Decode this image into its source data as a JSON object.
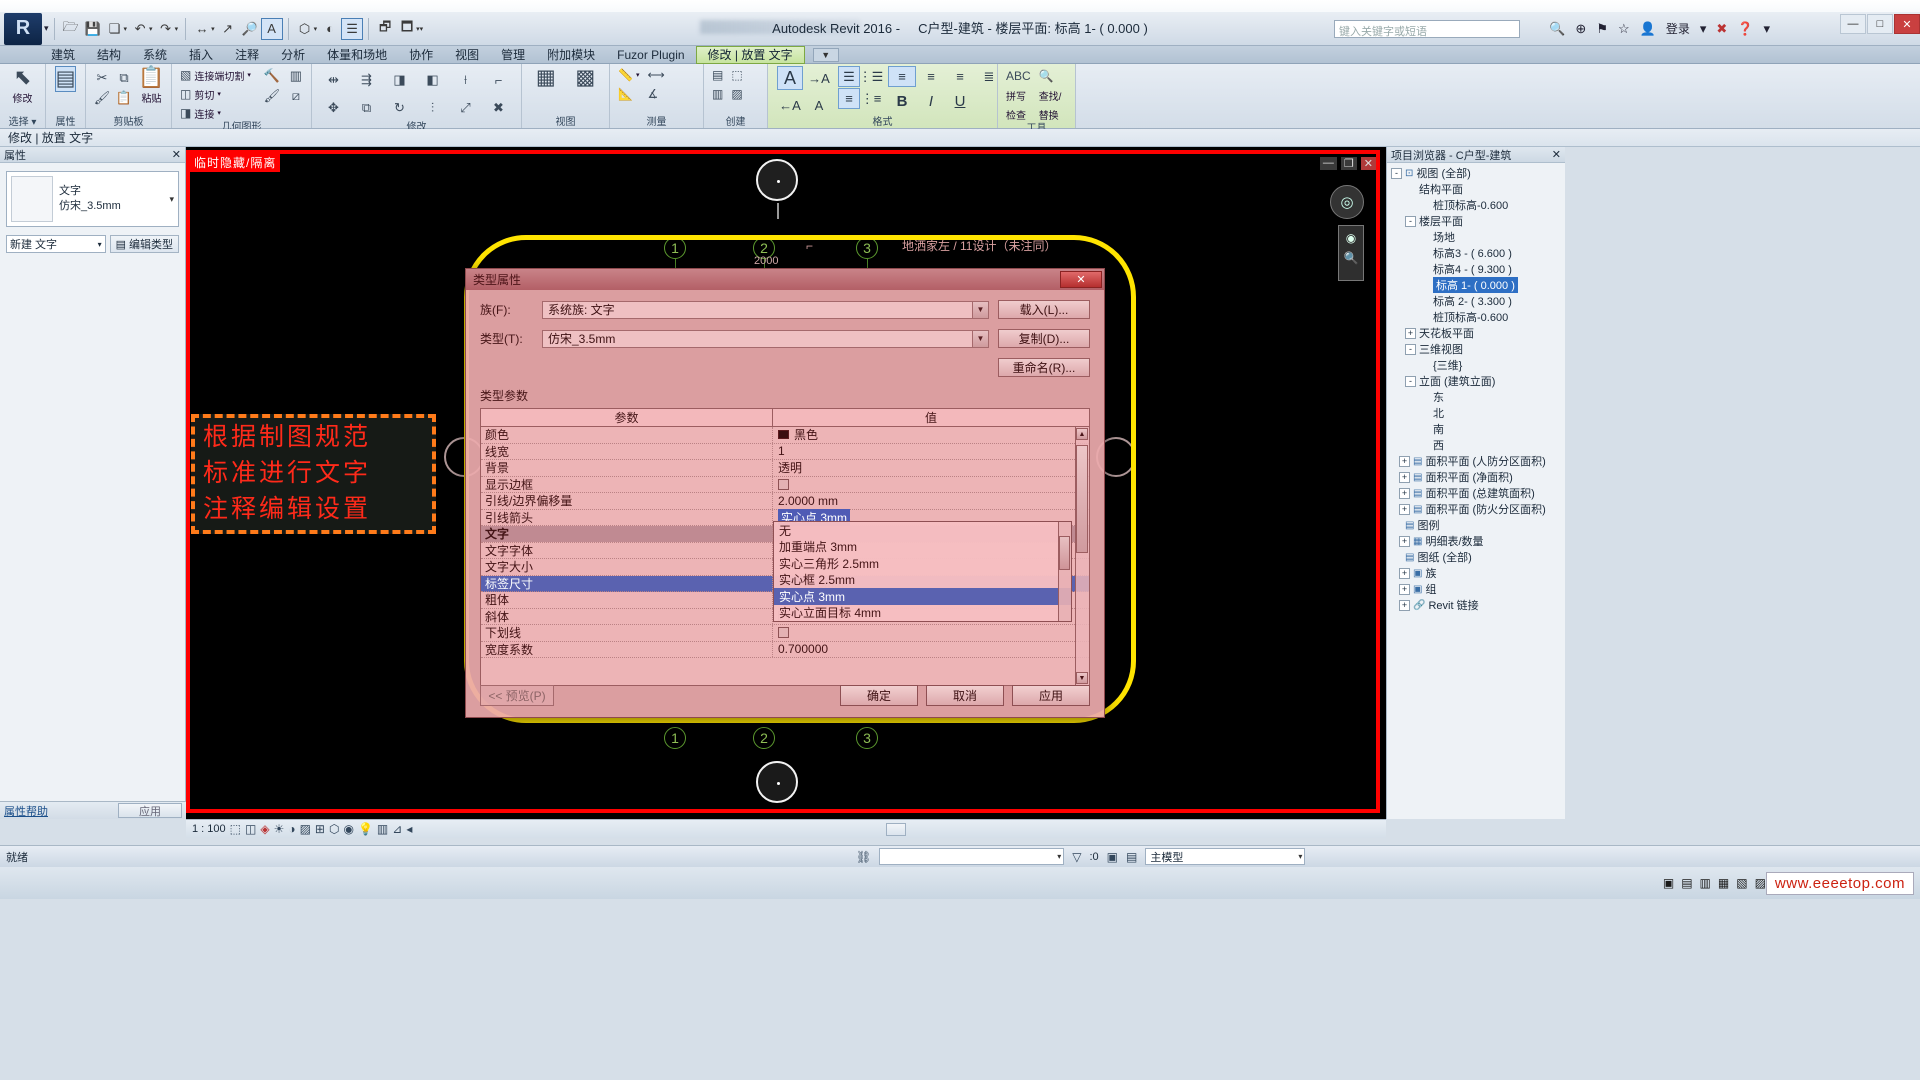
{
  "window": {
    "title": "Autodesk Revit 2016 -",
    "document": "C户型-建筑 - 楼层平面: 标高 1- ( 0.000 )",
    "search_placeholder": "键入关键字或短语",
    "signin": "登录",
    "minimize": "—",
    "maximize": "□",
    "close": "✕"
  },
  "quick_access": [
    {
      "name": "open-icon",
      "glyph": "🗁"
    },
    {
      "name": "save-icon",
      "glyph": "💾"
    },
    {
      "name": "save-as-icon",
      "glyph": "❐"
    },
    {
      "name": "undo-icon",
      "glyph": "↶"
    },
    {
      "name": "redo-icon",
      "glyph": "↷"
    },
    {
      "name": "measure-icon",
      "glyph": "↔"
    },
    {
      "name": "align-dimension-icon",
      "glyph": "↗"
    },
    {
      "name": "tag-icon",
      "glyph": "🔍"
    },
    {
      "name": "text-icon",
      "glyph": "A"
    },
    {
      "name": "default-3d-view-icon",
      "glyph": "⬡"
    },
    {
      "name": "section-icon",
      "glyph": "◔"
    },
    {
      "name": "thin-lines-icon",
      "glyph": "☰"
    },
    {
      "name": "close-hidden-windows-icon",
      "glyph": "🗗"
    },
    {
      "name": "switch-windows-icon",
      "glyph": "🗖"
    }
  ],
  "ribbon": {
    "tabs": [
      {
        "label": "建筑",
        "active": false
      },
      {
        "label": "结构",
        "active": false
      },
      {
        "label": "系统",
        "active": false
      },
      {
        "label": "插入",
        "active": false
      },
      {
        "label": "注释",
        "active": false
      },
      {
        "label": "分析",
        "active": false
      },
      {
        "label": "体量和场地",
        "active": false
      },
      {
        "label": "协作",
        "active": false
      },
      {
        "label": "视图",
        "active": false
      },
      {
        "label": "管理",
        "active": false
      },
      {
        "label": "附加模块",
        "active": false
      },
      {
        "label": "Fuzor Plugin",
        "active": false
      },
      {
        "label": "修改 | 放置 文字",
        "active": true
      }
    ],
    "tab_close": "▼",
    "panels": [
      {
        "title": "选择 ▾",
        "name": "select"
      },
      {
        "title": "属性",
        "name": "properties"
      },
      {
        "title": "剪贴板",
        "name": "clipboard"
      },
      {
        "title": "几何图形",
        "name": "geometry"
      },
      {
        "title": "修改",
        "name": "modify"
      },
      {
        "title": "视图",
        "name": "view"
      },
      {
        "title": "测量",
        "name": "measure"
      },
      {
        "title": "创建",
        "name": "create"
      },
      {
        "title": "格式",
        "name": "format"
      },
      {
        "title": "工具",
        "name": "tools"
      }
    ],
    "select_panel": {
      "modify_label": "修改"
    },
    "properties_panel": {
      "label": "属性"
    },
    "clipboard_panel": {
      "paste": "粘贴",
      "cut": "剪切",
      "copy": "复制",
      "match": "连接"
    },
    "geometry_panel": {
      "join_end": "连接端切割",
      "cut": "剪切",
      "join": "连接"
    },
    "format_panel": {
      "a_big": "A",
      "a_small": "A",
      "bold": "B",
      "italic": "I",
      "underline": "U"
    },
    "tools_panel": {
      "spell": "ABC",
      "check": "拼写\n检查",
      "find": "查找/\n替换"
    }
  },
  "context_bar": {
    "label": "修改 | 放置 文字"
  },
  "properties_palette": {
    "header": "属性",
    "close": "✕",
    "type_family": "文字",
    "type_name": "仿宋_3.5mm",
    "new_selector": "新建 文字",
    "edit_type": "编辑类型",
    "help_link": "属性帮助",
    "apply": "应用"
  },
  "canvas": {
    "view_control_label": "临时隐藏/隔离",
    "minimize": "—",
    "restore": "❐",
    "close": "✕",
    "dimension": "2000",
    "annotation": "地洒家左 / 11设计（未注同）",
    "grid_bubbles_top": [
      "1",
      "2",
      "3"
    ],
    "grid_bubbles_bottom": [
      "1",
      "2",
      "3"
    ]
  },
  "annotation_note": {
    "line1": "根据制图规范",
    "line2": "标准进行文字",
    "line3": "注释编辑设置"
  },
  "dialog": {
    "title": "类型属性",
    "close": "✕",
    "family_label": "族(F):",
    "family_value": "系统族: 文字",
    "type_label": "类型(T):",
    "type_value": "仿宋_3.5mm",
    "load_button": "载入(L)...",
    "duplicate_button": "复制(D)...",
    "rename_button": "重命名(R)...",
    "section_title": "类型参数",
    "col_param": "参数",
    "col_value": "值",
    "rows": [
      {
        "param": "颜色",
        "value": "黑色",
        "kind": "color"
      },
      {
        "param": "线宽",
        "value": "1",
        "kind": "text"
      },
      {
        "param": "背景",
        "value": "透明",
        "kind": "text"
      },
      {
        "param": "显示边框",
        "value": "",
        "kind": "checkbox"
      },
      {
        "param": "引线/边界偏移量",
        "value": "2.0000 mm",
        "kind": "text"
      },
      {
        "param": "引线箭头",
        "value": "实心点 3mm",
        "kind": "combo-selected"
      },
      {
        "param": "文字",
        "value": "",
        "kind": "group"
      },
      {
        "param": "文字字体",
        "value": "",
        "kind": "text"
      },
      {
        "param": "文字大小",
        "value": "",
        "kind": "text"
      },
      {
        "param": "标签尺寸",
        "value": "实心点 3mm",
        "kind": "highlight"
      },
      {
        "param": "粗体",
        "value": "",
        "kind": "text"
      },
      {
        "param": "斜体",
        "value": "",
        "kind": "checkbox"
      },
      {
        "param": "下划线",
        "value": "",
        "kind": "checkbox"
      },
      {
        "param": "宽度系数",
        "value": "0.700000",
        "kind": "text"
      }
    ],
    "dropdown_options": [
      "无",
      "加重端点 3mm",
      "实心三角形 2.5mm",
      "实心框 2.5mm",
      "实心点 3mm",
      "实心立面目标 4mm"
    ],
    "dropdown_selected_index": 4,
    "preview_button": "<< 预览(P)",
    "ok_button": "确定",
    "cancel_button": "取消",
    "apply_button": "应用"
  },
  "project_browser": {
    "header": "项目浏览器 - C户型-建筑",
    "close": "✕",
    "nodes": [
      {
        "label": "视图 (全部)",
        "indent": 0,
        "exp": "-",
        "icon": "⊡",
        "sel": false
      },
      {
        "label": "结构平面",
        "indent": 1,
        "exp": "",
        "icon": "",
        "sel": false
      },
      {
        "label": "桩顶标高-0.600",
        "indent": 2,
        "exp": "",
        "icon": "",
        "sel": false
      },
      {
        "label": "楼层平面",
        "indent": 1,
        "exp": "-",
        "icon": "",
        "sel": false
      },
      {
        "label": "场地",
        "indent": 2,
        "exp": "",
        "icon": "",
        "sel": false
      },
      {
        "label": "标高3 - ( 6.600 )",
        "indent": 2,
        "exp": "",
        "icon": "",
        "sel": false
      },
      {
        "label": "标高4 - ( 9.300 )",
        "indent": 2,
        "exp": "",
        "icon": "",
        "sel": false
      },
      {
        "label": "标高 1- ( 0.000 )",
        "indent": 2,
        "exp": "",
        "icon": "",
        "sel": true
      },
      {
        "label": "标高 2- ( 3.300 )",
        "indent": 2,
        "exp": "",
        "icon": "",
        "sel": false
      },
      {
        "label": "桩顶标高-0.600",
        "indent": 2,
        "exp": "",
        "icon": "",
        "sel": false
      },
      {
        "label": "天花板平面",
        "indent": 1,
        "exp": "+",
        "icon": "",
        "sel": false
      },
      {
        "label": "三维视图",
        "indent": 1,
        "exp": "-",
        "icon": "",
        "sel": false
      },
      {
        "label": "{三维}",
        "indent": 2,
        "exp": "",
        "icon": "",
        "sel": false
      },
      {
        "label": "立面 (建筑立面)",
        "indent": 1,
        "exp": "-",
        "icon": "",
        "sel": false
      },
      {
        "label": "东",
        "indent": 2,
        "exp": "",
        "icon": "",
        "sel": false
      },
      {
        "label": "北",
        "indent": 2,
        "exp": "",
        "icon": "",
        "sel": false
      },
      {
        "label": "南",
        "indent": 2,
        "exp": "",
        "icon": "",
        "sel": false
      },
      {
        "label": "西",
        "indent": 2,
        "exp": "",
        "icon": "",
        "sel": false
      },
      {
        "label": "面积平面 (人防分区面积)",
        "indent": 1,
        "exp": "+",
        "icon": "",
        "sel": false
      },
      {
        "label": "面积平面 (净面积)",
        "indent": 1,
        "exp": "+",
        "icon": "",
        "sel": false
      },
      {
        "label": "面积平面 (总建筑面积)",
        "indent": 1,
        "exp": "+",
        "icon": "",
        "sel": false
      },
      {
        "label": "面积平面 (防火分区面积)",
        "indent": 1,
        "exp": "+",
        "icon": "",
        "sel": false
      },
      {
        "label": "图例",
        "indent": 0,
        "exp": "",
        "icon": "▤",
        "sel": false
      },
      {
        "label": "明细表/数量",
        "indent": 0,
        "exp": "+",
        "icon": "▦",
        "sel": false
      },
      {
        "label": "图纸 (全部)",
        "indent": 0,
        "exp": "",
        "icon": "▤",
        "sel": false
      },
      {
        "label": "族",
        "indent": 0,
        "exp": "+",
        "icon": "▣",
        "sel": false
      },
      {
        "label": "组",
        "indent": 0,
        "exp": "+",
        "icon": "▣",
        "sel": false
      },
      {
        "label": "Revit 链接",
        "indent": 0,
        "exp": "+",
        "icon": "🔗",
        "sel": false
      }
    ]
  },
  "view_bar": {
    "scale": "1 : 100",
    "icons": [
      "scale-icon",
      "detail-level-icon",
      "visual-style-icon",
      "sun-path-icon",
      "shadows-icon",
      "render-icon",
      "crop-view-icon",
      "crop-region-icon",
      "temporary-hide-icon",
      "reveal-hidden-icon",
      "analytical-model-icon",
      "worksharing-icon"
    ]
  },
  "status_bar": {
    "ready": "就绪",
    "filter_value": "",
    "count": ":0",
    "model_selector": "主模型",
    "press_drag": "",
    "filter_icon": "filter-icon"
  },
  "watermark": {
    "text": "www.eeeetop.com"
  },
  "colors": {
    "accent_red": "#ff0000",
    "accent_yellow": "#ffe400",
    "accent_orange": "#ff7b1a",
    "note_text": "#ff2a1a",
    "dialog_bg": "#eca9ac",
    "selection_blue": "#4f5bb5",
    "browser_selection": "#2e6fc4"
  }
}
